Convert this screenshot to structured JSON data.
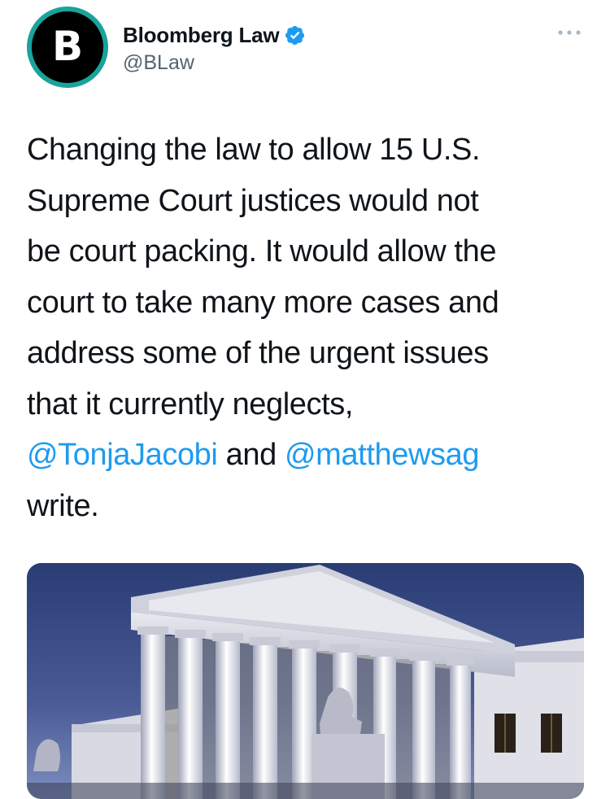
{
  "author": {
    "avatar_letter": "B",
    "display_name": "Bloomberg Law",
    "handle": "@BLaw",
    "verified": true
  },
  "tweet": {
    "text_line_1": "Changing the law to allow 15 U.S.",
    "text_line_2": "Supreme Court justices would not",
    "text_line_3": "be court packing. It would allow the",
    "text_line_4": "court to take many more cases and",
    "text_line_5": "address some of the urgent issues",
    "text_line_6": "that it currently neglects,",
    "mention_1": "@TonjaJacobi",
    "connector": " and ",
    "mention_2": "@matthewsag",
    "text_line_8": "write."
  },
  "media": {
    "subject": "supreme-court-building-photo"
  },
  "colors": {
    "link": "#1d9bf0",
    "verified": "#1d9bf0",
    "avatar_ring": "#1aa39a",
    "secondary_text": "#536471"
  },
  "icons": {
    "verified": "verified-badge-icon",
    "more": "more-options-icon"
  }
}
